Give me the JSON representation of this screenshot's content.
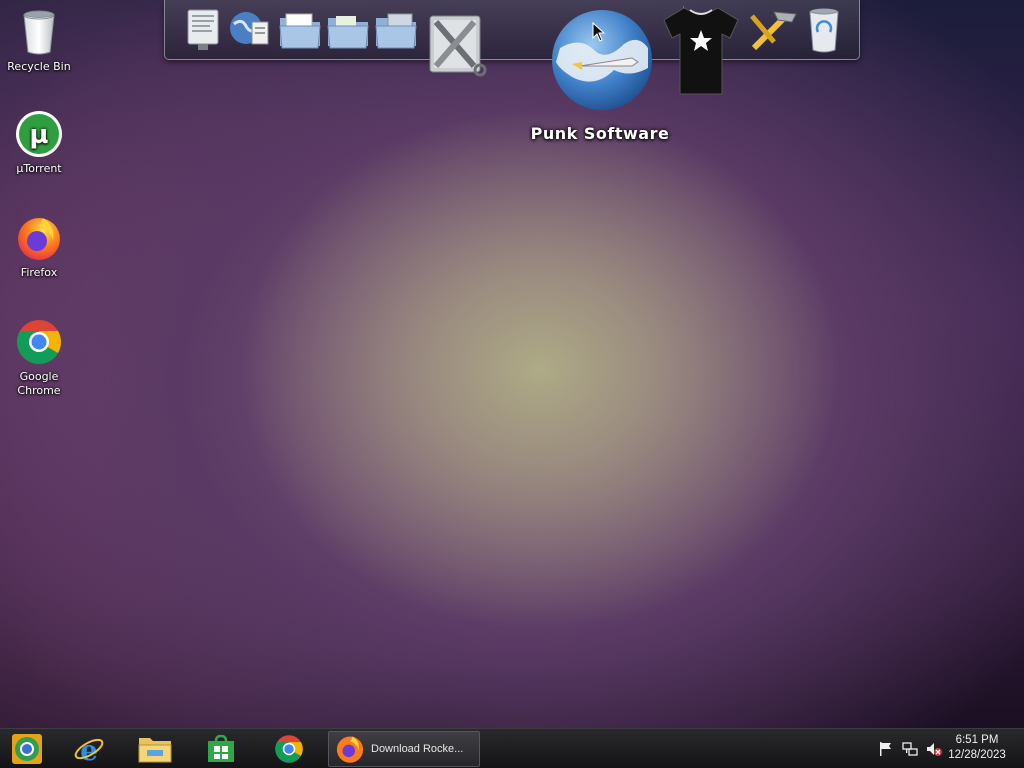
{
  "desktop": {
    "icons": [
      {
        "label": "Recycle Bin",
        "icon": "recycle-bin-icon"
      },
      {
        "label": "µTorrent",
        "icon": "utorrent-icon"
      },
      {
        "label": "Firefox",
        "icon": "firefox-icon"
      },
      {
        "label": "Google Chrome",
        "icon": "chrome-icon"
      }
    ]
  },
  "dock": {
    "hover_label": "Punk Software",
    "items": [
      "terminal-icon",
      "globe-document-icon",
      "documents-folder-icon",
      "folder-icon",
      "image-folder-icon",
      "tools-icon",
      "punk-software-icon",
      "tshirt-icon",
      "hammer-icon",
      "trash-icon"
    ]
  },
  "taskbar": {
    "pinned": [
      "chrome-canary-icon",
      "internet-explorer-icon",
      "file-explorer-icon",
      "store-icon",
      "chrome-icon"
    ],
    "active_task": {
      "label": "Download Rocke...",
      "icon": "firefox-icon"
    },
    "clock": {
      "time": "6:51 PM",
      "date": "12/28/2023"
    }
  }
}
